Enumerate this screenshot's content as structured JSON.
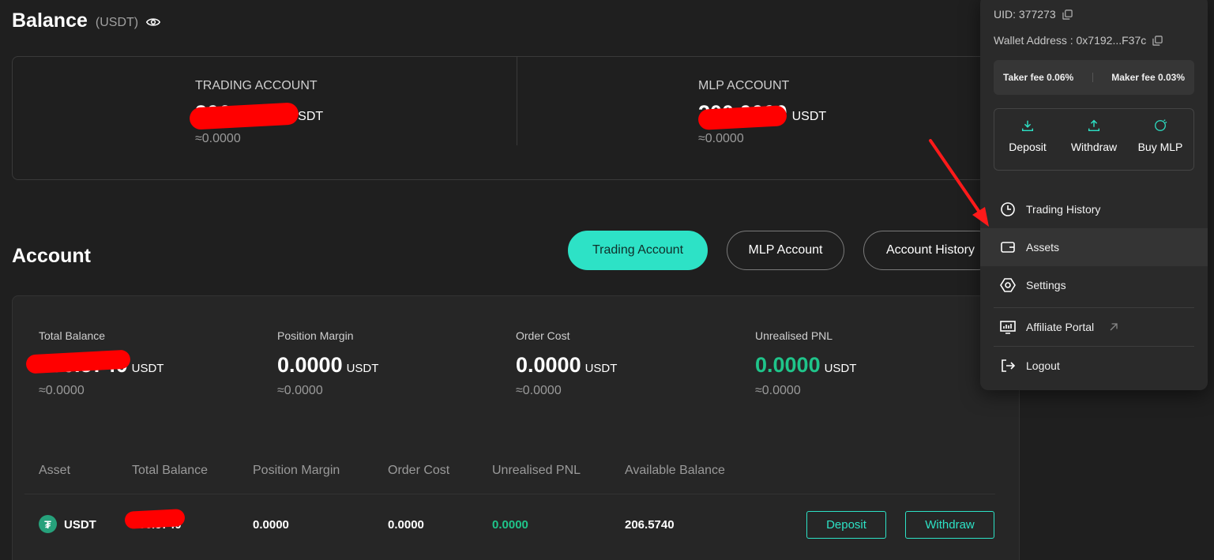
{
  "balance": {
    "title": "Balance",
    "unit": "(USDT)",
    "trading_account": {
      "label": "TRADING ACCOUNT",
      "value": "206.5740",
      "currency": "USDT",
      "approx": "≈0.0000"
    },
    "mlp_account": {
      "label": "MLP ACCOUNT",
      "value": "200.0000",
      "currency": "USDT",
      "approx": "≈0.0000"
    }
  },
  "account": {
    "title": "Account",
    "tabs": [
      "Trading Account",
      "MLP Account",
      "Account History"
    ],
    "stats": [
      {
        "label": "Total Balance",
        "value": "206.5740",
        "currency": "USDT",
        "approx": "≈0.0000"
      },
      {
        "label": "Position Margin",
        "value": "0.0000",
        "currency": "USDT",
        "approx": "≈0.0000"
      },
      {
        "label": "Order Cost",
        "value": "0.0000",
        "currency": "USDT",
        "approx": "≈0.0000"
      },
      {
        "label": "Unrealised PNL",
        "value": "0.0000",
        "currency": "USDT",
        "approx": "≈0.0000"
      }
    ],
    "table": {
      "headers": [
        "Asset",
        "Total Balance",
        "Position Margin",
        "Order Cost",
        "Unrealised PNL",
        "Available Balance"
      ],
      "rows": [
        {
          "asset": "USDT",
          "total_balance": "206.5740",
          "position_margin": "0.0000",
          "order_cost": "0.0000",
          "unrealised_pnl": "0.0000",
          "available_balance": "206.5740",
          "deposit_label": "Deposit",
          "withdraw_label": "Withdraw"
        }
      ]
    }
  },
  "dropdown": {
    "uid": "UID: 377273",
    "wallet": "Wallet Address : 0x7192...F37c",
    "taker_fee": "Taker fee 0.06%",
    "maker_fee": "Maker fee 0.03%",
    "actions": [
      "Deposit",
      "Withdraw",
      "Buy MLP"
    ],
    "menu": [
      "Trading History",
      "Assets",
      "Settings",
      "Affiliate Portal",
      "Logout"
    ]
  },
  "colors": {
    "accent": "#2de2c6",
    "positive": "#1fc48a",
    "annotation": "#ff0000"
  }
}
